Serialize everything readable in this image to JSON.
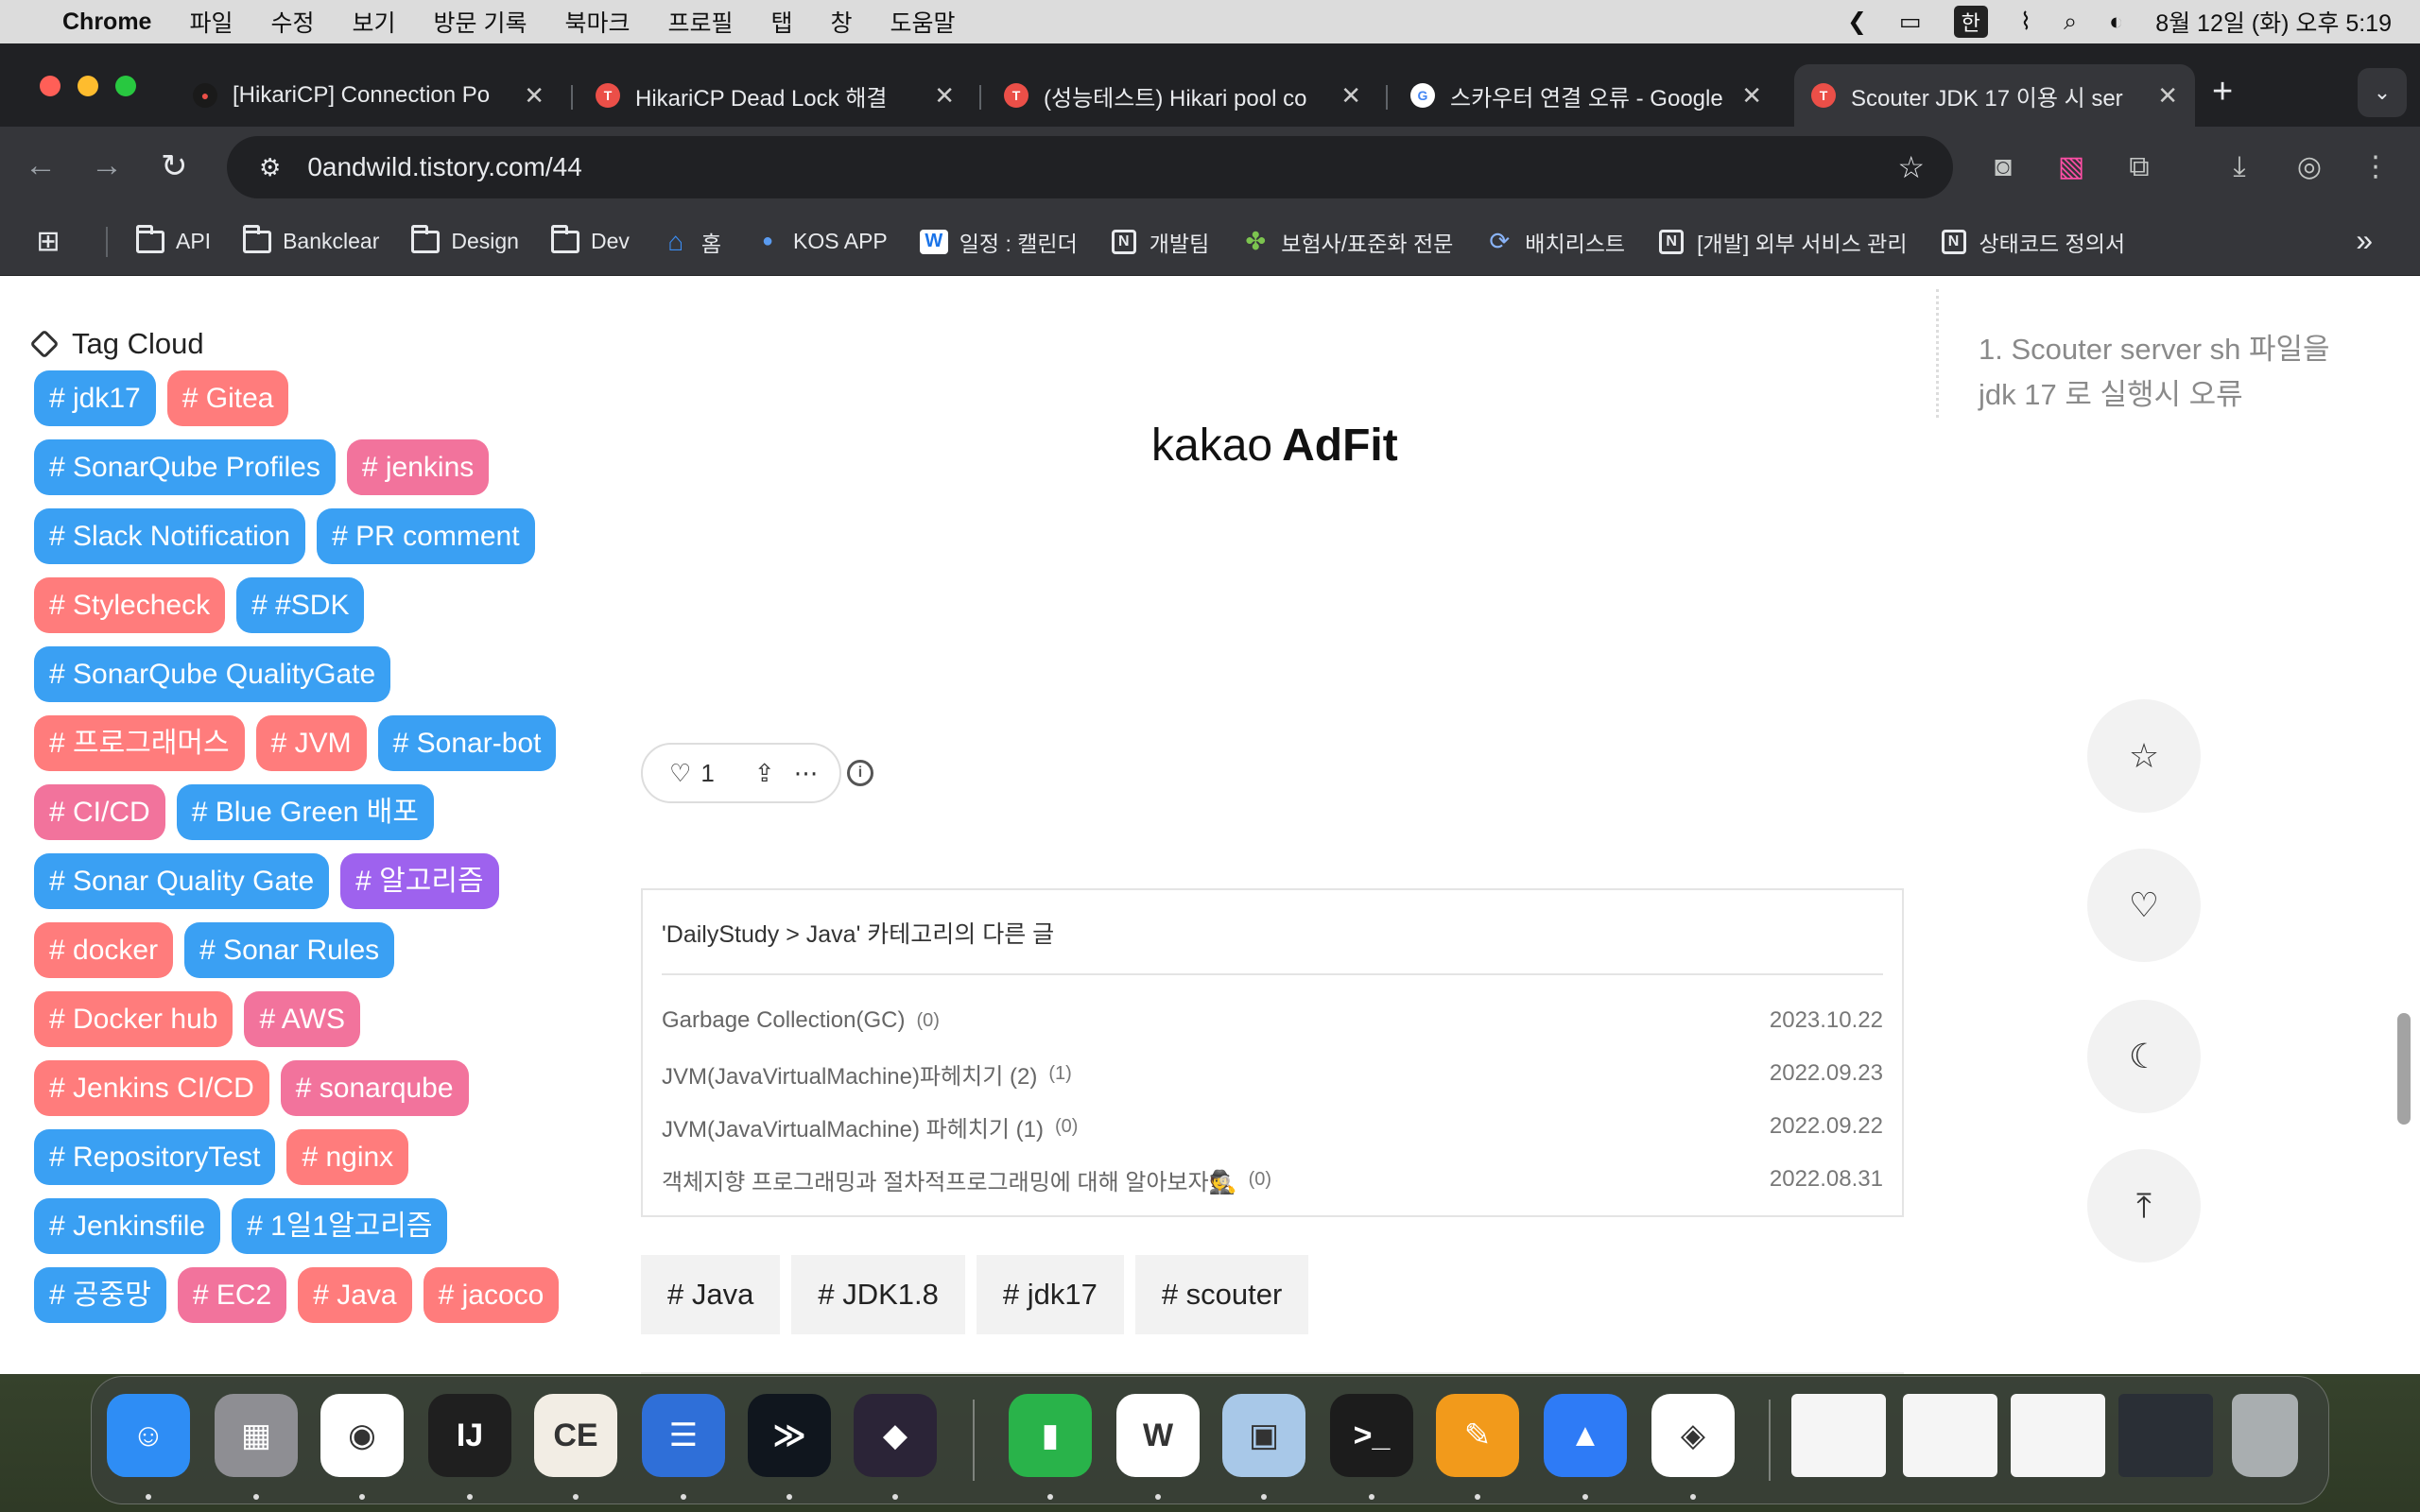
{
  "menubar": {
    "app": "Chrome",
    "items": [
      "파일",
      "수정",
      "보기",
      "방문 기록",
      "북마크",
      "프로필",
      "탭",
      "창",
      "도움말"
    ],
    "ime": "한",
    "datetime": "8월 12일 (화) 오후 5:19"
  },
  "tabs": [
    {
      "title": "[HikariCP] Connection Po",
      "fav_color": "#1a1a1a",
      "fav_glyph": "●"
    },
    {
      "title": "HikariCP Dead Lock 해결",
      "fav_color": "#eb4f48",
      "fav_glyph": "T"
    },
    {
      "title": "(성능테스트) Hikari pool co",
      "fav_color": "#eb4f48",
      "fav_glyph": "T"
    },
    {
      "title": "스카우터 연결 오류 - Google",
      "fav_color": "#ffffff",
      "fav_glyph": "G"
    },
    {
      "title": "Scouter JDK 17 이용 시 ser",
      "fav_color": "#eb4f48",
      "fav_glyph": "T"
    }
  ],
  "address": "0andwild.tistory.com/44",
  "bookmarks": [
    {
      "label": "API",
      "icon": "folder"
    },
    {
      "label": "Bankclear",
      "icon": "folder"
    },
    {
      "label": "Design",
      "icon": "folder"
    },
    {
      "label": "Dev",
      "icon": "folder"
    },
    {
      "label": "홈",
      "icon": "home-icon"
    },
    {
      "label": "KOS APP",
      "icon": "app-icon"
    },
    {
      "label": "일정 : 캘린더",
      "icon": "w-icon"
    },
    {
      "label": "개발팀",
      "icon": "notion-icon"
    },
    {
      "label": "보험사/표준화 전문",
      "icon": "puzzle-icon"
    },
    {
      "label": "배치리스트",
      "icon": "sync-icon"
    },
    {
      "label": "[개발] 외부 서비스 관리",
      "icon": "notion-icon"
    },
    {
      "label": "상태코드 정의서",
      "icon": "notion-icon"
    }
  ],
  "tagcloud": {
    "title": "Tag Cloud",
    "tags": [
      {
        "text": "# jdk17",
        "color": "blue"
      },
      {
        "text": "# Gitea",
        "color": "red"
      },
      {
        "text": "# SonarQube Profiles",
        "color": "blue"
      },
      {
        "text": "# jenkins",
        "color": "pink"
      },
      {
        "text": "# Slack Notification",
        "color": "blue"
      },
      {
        "text": "# PR comment",
        "color": "blue"
      },
      {
        "text": "# Stylecheck",
        "color": "red"
      },
      {
        "text": "# #SDK",
        "color": "blue"
      },
      {
        "text": "# SonarQube QualityGate",
        "color": "blue"
      },
      {
        "text": "# 프로그래머스",
        "color": "red"
      },
      {
        "text": "# JVM",
        "color": "red"
      },
      {
        "text": "# Sonar-bot",
        "color": "blue"
      },
      {
        "text": "# CI/CD",
        "color": "pink"
      },
      {
        "text": "# Blue Green 배포",
        "color": "blue"
      },
      {
        "text": "# Sonar Quality Gate",
        "color": "blue"
      },
      {
        "text": "# 알고리즘",
        "color": "purple"
      },
      {
        "text": "# docker",
        "color": "red"
      },
      {
        "text": "# Sonar Rules",
        "color": "blue"
      },
      {
        "text": "# Docker hub",
        "color": "red"
      },
      {
        "text": "# AWS",
        "color": "pink"
      },
      {
        "text": "# Jenkins CI/CD",
        "color": "red"
      },
      {
        "text": "# sonarqube",
        "color": "pink"
      },
      {
        "text": "# RepositoryTest",
        "color": "blue"
      },
      {
        "text": "# nginx",
        "color": "red"
      },
      {
        "text": "# Jenkinsfile",
        "color": "blue"
      },
      {
        "text": "# 1일1알고리즘",
        "color": "blue"
      },
      {
        "text": "# 공중망",
        "color": "blue"
      },
      {
        "text": "# EC2",
        "color": "pink"
      },
      {
        "text": "# Java",
        "color": "red"
      },
      {
        "text": "# jacoco",
        "color": "red"
      }
    ]
  },
  "adfit": {
    "prefix": "kakao",
    "brand": "AdFit"
  },
  "toc": {
    "item": "1. Scouter server sh 파일을 jdk 17 로 실행시 오류"
  },
  "like": {
    "count": "1"
  },
  "related": {
    "title": "'DailyStudy > Java' 카테고리의 다른 글",
    "items": [
      {
        "title": "Garbage Collection(GC)",
        "count": "(0)",
        "date": "2023.10.22"
      },
      {
        "title": "JVM(JavaVirtualMachine)파헤치기 (2)",
        "count": "(1)",
        "date": "2022.09.23"
      },
      {
        "title": "JVM(JavaVirtualMachine) 파헤치기 (1)",
        "count": "(0)",
        "date": "2022.09.22"
      },
      {
        "title": "객체지향 프로그래밍과 절차적프로그래밍에 대해 알아보자🕵️",
        "count": "(0)",
        "date": "2022.08.31"
      }
    ]
  },
  "post_tags": [
    "# Java",
    "# JDK1.8",
    "# jdk17",
    "# scouter"
  ],
  "colors": {
    "tag_blue": "#3aa0f3",
    "tag_red": "#ff7c7c",
    "tag_pink": "#f2739c",
    "tag_purple": "#9e62ee"
  },
  "dock": [
    {
      "name": "finder",
      "glyph": "☺",
      "bg": "#2e8df5"
    },
    {
      "name": "launchpad",
      "glyph": "▦",
      "bg": "#8e8e93"
    },
    {
      "name": "chrome",
      "glyph": "◉",
      "bg": "#ffffff"
    },
    {
      "name": "intellij",
      "glyph": "IJ",
      "bg": "#1f1f1f"
    },
    {
      "name": "dbeaver",
      "glyph": "CE",
      "bg": "#f2ede4"
    },
    {
      "name": "files",
      "glyph": "☰",
      "bg": "#2f6fd8"
    },
    {
      "name": "vscode-like",
      "glyph": "≫",
      "bg": "#10161e"
    },
    {
      "name": "obsidian",
      "glyph": "◆",
      "bg": "#2b2437"
    },
    {
      "name": "numbers",
      "glyph": "▮",
      "bg": "#29b34a"
    },
    {
      "name": "naver-whale",
      "glyph": "W",
      "bg": "#ffffff"
    },
    {
      "name": "preview",
      "glyph": "▣",
      "bg": "#a8c8e8"
    },
    {
      "name": "terminal",
      "glyph": ">_",
      "bg": "#1c1c1c"
    },
    {
      "name": "pages",
      "glyph": "✎",
      "bg": "#f29a1b"
    },
    {
      "name": "keynote",
      "glyph": "▲",
      "bg": "#2e7bf6"
    },
    {
      "name": "naver-box",
      "glyph": "◈",
      "bg": "#ffffff"
    }
  ]
}
